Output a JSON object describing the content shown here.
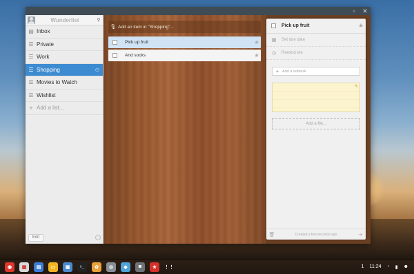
{
  "colors": {
    "accent": "#3d8bd0",
    "wood": "#95552d",
    "panel": "#f0f0f0"
  },
  "titlebar": {
    "maximize_icon": "maximize-icon",
    "close_icon": "close-icon"
  },
  "sidebar": {
    "app_title": "Wunderlist",
    "lists": [
      {
        "label": "Inbox",
        "icon": "inbox-icon"
      },
      {
        "label": "Private",
        "icon": "list-icon"
      },
      {
        "label": "Work",
        "icon": "list-icon"
      },
      {
        "label": "Shopping",
        "icon": "list-icon",
        "active": true
      },
      {
        "label": "Movies to Watch",
        "icon": "list-icon"
      },
      {
        "label": "Wishlist",
        "icon": "list-icon"
      }
    ],
    "add_list": "Add a list...",
    "edit_label": "Edit"
  },
  "tasks": {
    "add_placeholder": "Add an item in \"Shopping\"...",
    "items": [
      {
        "label": "Pick up fruit",
        "selected": true
      },
      {
        "label": "And socks",
        "selected": false
      }
    ]
  },
  "detail": {
    "title": "Pick up fruit",
    "due_date": "Set due date",
    "remind": "Remind me",
    "subtask_placeholder": "Add a subtask",
    "add_file": "Add a file...",
    "created": "Created a few seconds ago"
  },
  "shelf": {
    "apps": [
      "chrome-icon",
      "calendar-icon",
      "files-icon",
      "docs-icon",
      "monitor-icon",
      "terminal-icon",
      "photos-icon",
      "camera-icon",
      "app-icon",
      "camera-icon-2",
      "wunderlist-icon",
      "launcher-icon"
    ],
    "notification_count": "1",
    "time": "11:24"
  }
}
